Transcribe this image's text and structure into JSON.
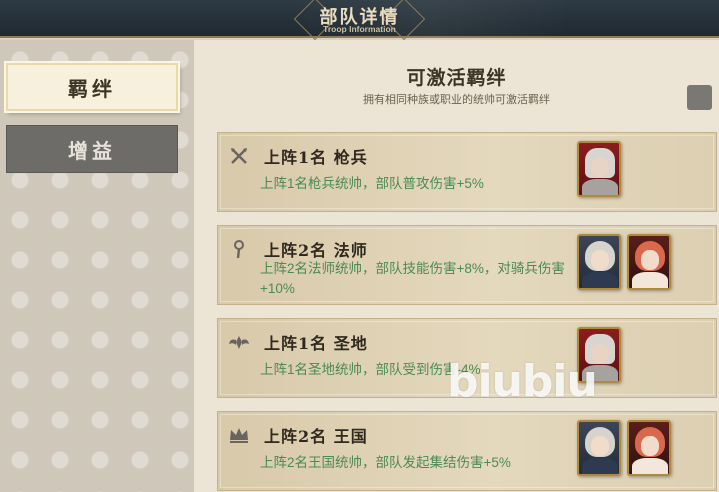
{
  "header": {
    "title": "部队详情",
    "subtitle": "Troop Information"
  },
  "sidebar": {
    "tabs": [
      {
        "label": "羁绊",
        "active": true
      },
      {
        "label": "增益",
        "active": false
      }
    ]
  },
  "main": {
    "title": "可激活羁绊",
    "subtitle": "拥有相同种族或职业的统帅可激活羁绊",
    "cards": [
      {
        "icon": "crossed-spears-icon",
        "title": "上阵1名 枪兵",
        "desc": "上阵1名枪兵统帅，部队普攻伤害+5%",
        "portraits": [
          "lancer-commander-portrait"
        ]
      },
      {
        "icon": "staff-icon",
        "title": "上阵2名 法师",
        "desc": "上阵2名法师统帅，部队技能伤害+8%，对骑兵伤害+10%",
        "portraits": [
          "silver-hair-commander-portrait",
          "red-hair-commander-portrait"
        ]
      },
      {
        "icon": "winged-emblem-icon",
        "title": "上阵1名 圣地",
        "desc": "上阵1名圣地统帅，部队受到伤害-4%",
        "portraits": [
          "lancer-commander-portrait"
        ]
      },
      {
        "icon": "crown-icon",
        "title": "上阵2名 王国",
        "desc": "上阵2名王国统帅，部队发起集结伤害+5%",
        "portraits": [
          "silver-hair-commander-portrait",
          "red-hair-commander-portrait"
        ]
      }
    ]
  },
  "watermark": "biubiu",
  "colors": {
    "header_bg": "#253038",
    "accent_text": "#4a8a54",
    "active_tab_bg": "#f7f0dc",
    "inactive_tab_bg": "#6e6c69"
  }
}
